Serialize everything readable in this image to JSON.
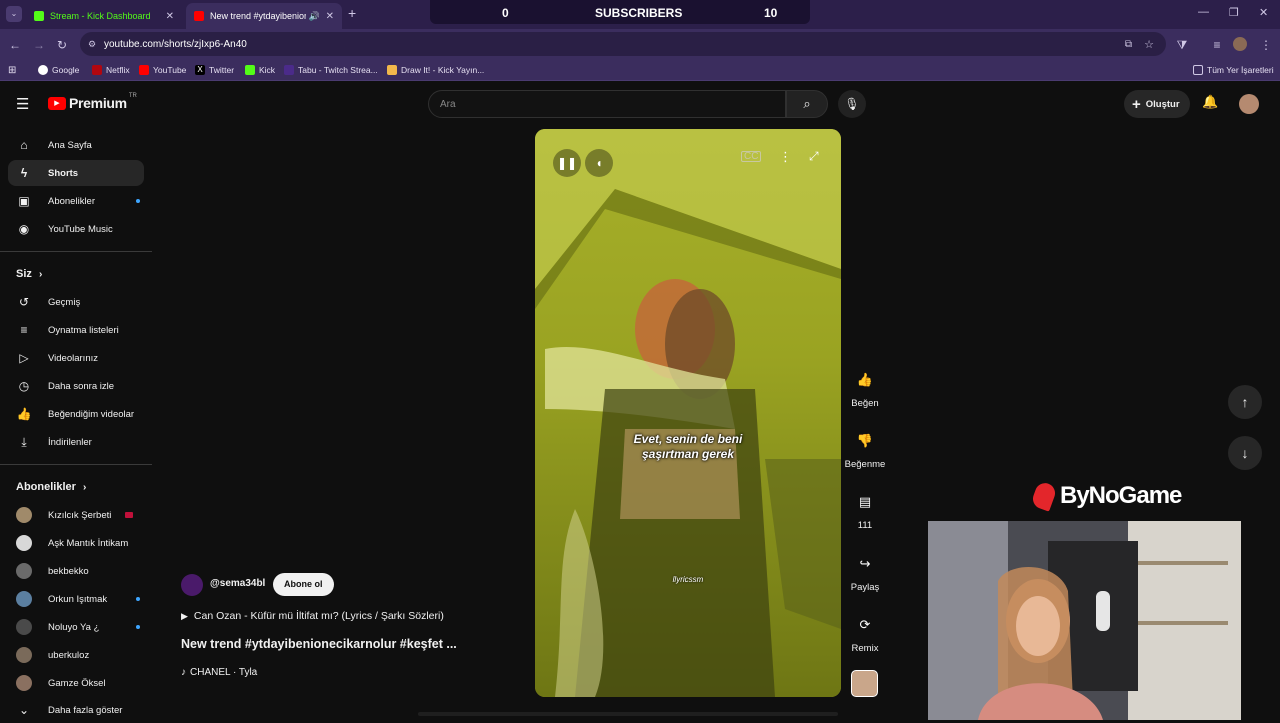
{
  "browser": {
    "tabs": [
      {
        "title": "Stream - Kick Dashboard"
      },
      {
        "title": "New trend #ytdayibenione"
      }
    ],
    "url": "youtube.com/shorts/zjIxp6-An40",
    "bookmarks": [
      "Google",
      "Netflix",
      "YouTube",
      "Twitter",
      "Kick",
      "Tabu - Twitch Strea...",
      "Draw It! - Kick Yayın..."
    ],
    "all_bookmarks": "Tüm Yer İşaretleri"
  },
  "overlay": {
    "subs_left": "0",
    "subs_label": "SUBSCRIBERS",
    "subs_right": "10",
    "brand": "ByNoGame"
  },
  "youtube": {
    "logo": "Premium",
    "logo_sup": "TR",
    "search_placeholder": "Ara",
    "create_label": "Oluştur",
    "sidebar": {
      "main": [
        {
          "label": "Ana Sayfa",
          "icon": "home-icon"
        },
        {
          "label": "Shorts",
          "icon": "shorts-icon"
        },
        {
          "label": "Abonelikler",
          "icon": "subscriptions-icon"
        },
        {
          "label": "YouTube Music",
          "icon": "music-icon"
        }
      ],
      "you_header": "Siz",
      "you": [
        {
          "label": "Geçmiş"
        },
        {
          "label": "Oynatma listeleri"
        },
        {
          "label": "Videolarınız"
        },
        {
          "label": "Daha sonra izle"
        },
        {
          "label": "Beğendiğim videolar"
        },
        {
          "label": "İndirilenler"
        }
      ],
      "subs_header": "Abonelikler",
      "subs": [
        {
          "label": "Kızılcık Şerbeti"
        },
        {
          "label": "Aşk Mantık İntikam"
        },
        {
          "label": "bekbekko"
        },
        {
          "label": "Orkun Işıtmak"
        },
        {
          "label": "Noluyo Ya ¿"
        },
        {
          "label": "uberkuloz"
        },
        {
          "label": "Gamze Öksel"
        }
      ],
      "show_more": "Daha fazla göster"
    },
    "short": {
      "caption_line1": "Evet, senin de beni",
      "caption_line2": "şaşırtman gerek",
      "watermark": "llyricssm",
      "channel": "@sema34bl",
      "subscribe": "Abone ol",
      "song_link": "Can Ozan - Küfür mü İltifat mı? (Lyrics / Şarkı Sözleri)",
      "title": "New trend #ytdayibenionecikarnolur #keşfet ...",
      "music": "CHANEL · Tyla"
    },
    "actions": {
      "like": "Beğen",
      "dislike": "Beğenme",
      "comments": "111",
      "share": "Paylaş",
      "remix": "Remix"
    }
  }
}
